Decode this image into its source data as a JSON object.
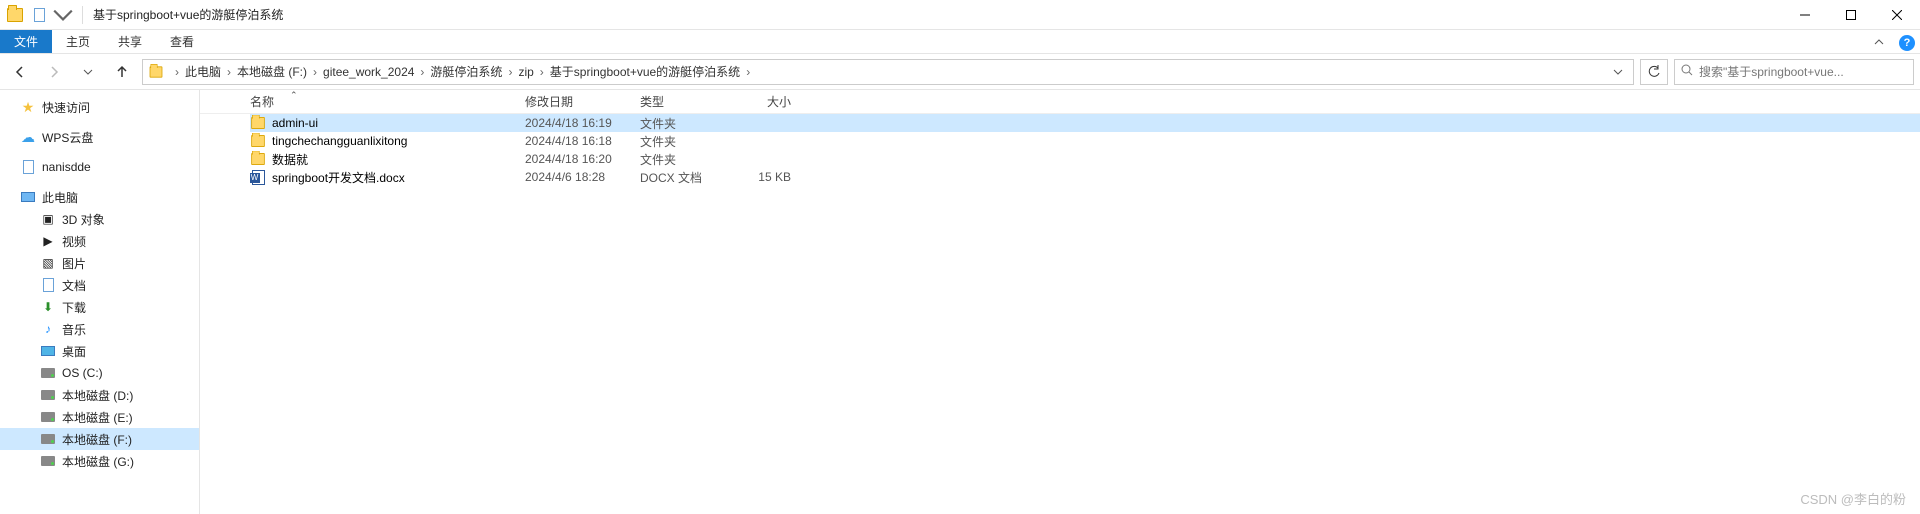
{
  "window": {
    "title": "基于springboot+vue的游艇停泊系统"
  },
  "ribbon": {
    "tabs": [
      "文件",
      "主页",
      "共享",
      "查看"
    ],
    "help_tip": "?"
  },
  "breadcrumbs": {
    "items": [
      "此电脑",
      "本地磁盘 (F:)",
      "gitee_work_2024",
      "游艇停泊系统",
      "zip",
      "基于springboot+vue的游艇停泊系统"
    ]
  },
  "search": {
    "placeholder": "搜索\"基于springboot+vue..."
  },
  "sidebar": {
    "quick_access": "快速访问",
    "wps_cloud": "WPS云盘",
    "nanisdde": "nanisdde",
    "this_pc": "此电脑",
    "sub": {
      "objects3d": "3D 对象",
      "videos": "视频",
      "pictures": "图片",
      "documents": "文档",
      "downloads": "下载",
      "music": "音乐",
      "desktop": "桌面",
      "os_c": "OS (C:)",
      "disk_d": "本地磁盘 (D:)",
      "disk_e": "本地磁盘 (E:)",
      "disk_f": "本地磁盘 (F:)",
      "disk_g": "本地磁盘 (G:)"
    }
  },
  "columns": {
    "name": "名称",
    "date": "修改日期",
    "type": "类型",
    "size": "大小"
  },
  "rows": [
    {
      "name": "admin-ui",
      "date": "2024/4/18 16:19",
      "type": "文件夹",
      "size": "",
      "kind": "folder",
      "selected": true
    },
    {
      "name": "tingchechangguanlixitong",
      "date": "2024/4/18 16:18",
      "type": "文件夹",
      "size": "",
      "kind": "folder"
    },
    {
      "name": "数据就",
      "date": "2024/4/18 16:20",
      "type": "文件夹",
      "size": "",
      "kind": "folder"
    },
    {
      "name": "springboot开发文档.docx",
      "date": "2024/4/6 18:28",
      "type": "DOCX 文档",
      "size": "15 KB",
      "kind": "docx"
    }
  ],
  "watermark": "CSDN @李白的粉"
}
